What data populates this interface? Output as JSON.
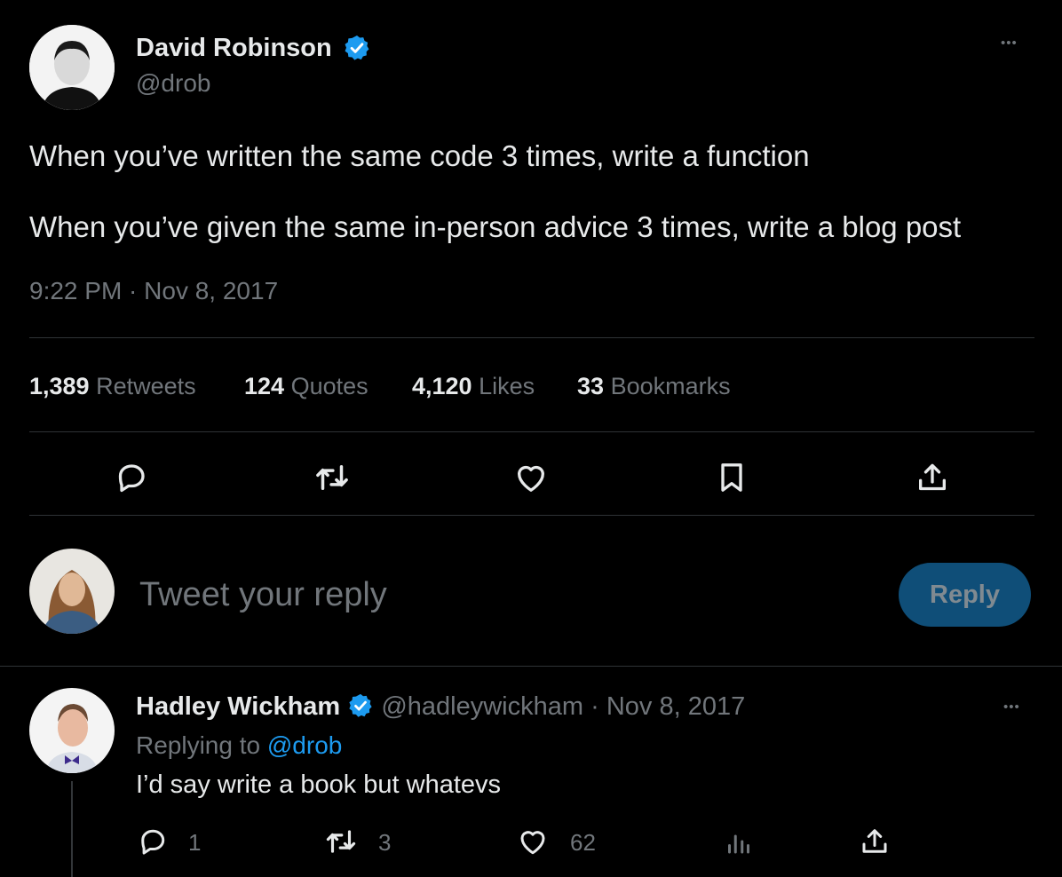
{
  "tweet": {
    "author_name": "David Robinson",
    "author_handle": "@drob",
    "line1": "When you’ve written the same code 3 times, write a function",
    "line2": "When you’ve given the same in-person advice 3 times, write a blog post",
    "timestamp": "9:22 PM · Nov 8, 2017",
    "more_glyph": "•••"
  },
  "stats": {
    "retweets_count": "1,389",
    "retweets_label": "Retweets",
    "quotes_count": "124",
    "quotes_label": "Quotes",
    "likes_count": "4,120",
    "likes_label": "Likes",
    "bookmarks_count": "33",
    "bookmarks_label": "Bookmarks"
  },
  "composer": {
    "placeholder": "Tweet your reply",
    "reply_button": "Reply"
  },
  "reply": {
    "author_name": "Hadley Wickham",
    "author_handle": "@hadleywickham",
    "dot": "·",
    "date": "Nov 8, 2017",
    "replying_prefix": "Replying to",
    "replying_handle": "@drob",
    "text": "I’d say write a book but whatevs",
    "more_glyph": "•••",
    "replies_count": "1",
    "retweets_count": "3",
    "likes_count": "62"
  },
  "colors": {
    "background": "#000000",
    "primary_text": "#e7e9ea",
    "secondary_text": "#71767b",
    "accent": "#1d9bf0",
    "verified_badge": "#1d9bf0",
    "reply_button_bg": "#0f4e78",
    "divider": "#2f3336"
  },
  "icons": [
    "verified-badge-icon",
    "more-icon",
    "reply-icon",
    "retweet-icon",
    "like-icon",
    "bookmark-icon",
    "share-icon",
    "analytics-icon"
  ]
}
